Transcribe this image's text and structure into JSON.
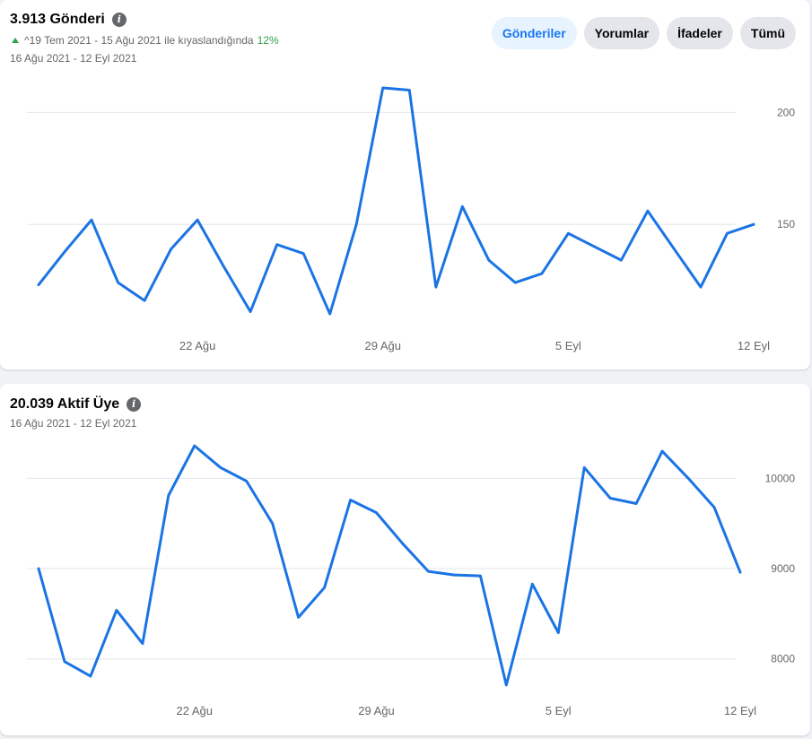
{
  "posts_card": {
    "title": "3.913 Gönderi",
    "comparison_text": "^19 Tem 2021 - 15 Ağu 2021 ile kıyaslandığında",
    "comparison_pct": "12%",
    "date_range": "16 Ağu 2021 - 12 Eyl 2021",
    "buttons": [
      {
        "label": "Gönderiler",
        "active": true
      },
      {
        "label": "Yorumlar",
        "active": false
      },
      {
        "label": "İfadeler",
        "active": false
      },
      {
        "label": "Tümü",
        "active": false
      }
    ]
  },
  "members_card": {
    "title": "20.039 Aktif Üye",
    "date_range": "16 Ağu 2021 - 12 Eyl 2021"
  },
  "colors": {
    "line": "#1b74e4",
    "up": "#31a24c",
    "active_button_text": "#1877f2"
  },
  "chart_data": [
    {
      "type": "line",
      "x": [
        "16 Ağu",
        "17 Ağu",
        "18 Ağu",
        "19 Ağu",
        "20 Ağu",
        "21 Ağu",
        "22 Ağu",
        "23 Ağu",
        "24 Ağu",
        "25 Ağu",
        "26 Ağu",
        "27 Ağu",
        "28 Ağu",
        "29 Ağu",
        "30 Ağu",
        "31 Ağu",
        "1 Eyl",
        "2 Eyl",
        "3 Eyl",
        "4 Eyl",
        "5 Eyl",
        "6 Eyl",
        "7 Eyl",
        "8 Eyl",
        "9 Eyl",
        "10 Eyl",
        "11 Eyl",
        "12 Eyl"
      ],
      "x_tick_labels": [
        "22 Ağu",
        "29 Ağu",
        "5 Eyl",
        "12 Eyl"
      ],
      "y_ticks": [
        150,
        200
      ],
      "ylim": [
        100,
        215
      ],
      "series": [
        {
          "values": [
            123,
            138,
            152,
            124,
            116,
            139,
            152,
            131,
            111,
            141,
            137,
            110,
            150,
            211,
            210,
            122,
            158,
            134,
            124,
            128,
            146,
            140,
            134,
            156,
            139,
            122,
            146,
            150
          ]
        }
      ],
      "grid": true
    },
    {
      "type": "line",
      "x": [
        "16 Ağu",
        "17 Ağu",
        "18 Ağu",
        "19 Ağu",
        "20 Ağu",
        "21 Ağu",
        "22 Ağu",
        "23 Ağu",
        "24 Ağu",
        "25 Ağu",
        "26 Ağu",
        "27 Ağu",
        "28 Ağu",
        "29 Ağu",
        "30 Ağu",
        "31 Ağu",
        "1 Eyl",
        "2 Eyl",
        "3 Eyl",
        "4 Eyl",
        "5 Eyl",
        "6 Eyl",
        "7 Eyl",
        "8 Eyl",
        "9 Eyl",
        "10 Eyl",
        "11 Eyl",
        "12 Eyl"
      ],
      "x_tick_labels": [
        "22 Ağu",
        "29 Ağu",
        "5 Eyl",
        "12 Eyl"
      ],
      "y_ticks": [
        8000,
        9000,
        10000
      ],
      "ylim": [
        7600,
        10500
      ],
      "series": [
        {
          "values": [
            9000,
            7970,
            7810,
            8540,
            8170,
            9810,
            10360,
            10120,
            9970,
            9500,
            8460,
            8790,
            9760,
            9620,
            9280,
            8970,
            8930,
            8920,
            7710,
            8830,
            8290,
            10120,
            9780,
            9720,
            10300,
            10000,
            9680,
            8960
          ]
        }
      ],
      "grid": true
    }
  ]
}
